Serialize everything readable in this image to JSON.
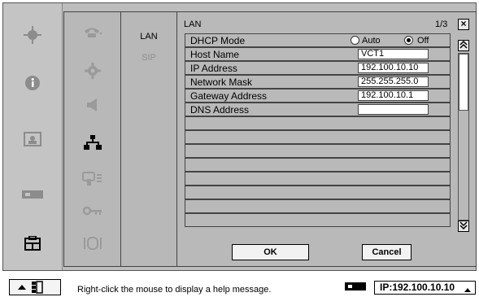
{
  "title": "LAN",
  "page_indicator": "1/3",
  "close_label": "×",
  "sidebar": {
    "icons": [
      "video-conference-icon",
      "info-icon",
      "camera-icon",
      "projector-icon",
      "layout-icon"
    ]
  },
  "categories": [
    "phone-icon",
    "gear-icon",
    "speaker-icon",
    "network-icon",
    "display-icon",
    "key-icon",
    "media-icon"
  ],
  "subcategories": [
    "LAN",
    "SIP"
  ],
  "rows": [
    {
      "label": "DHCP Mode",
      "type": "radio",
      "options": [
        "Auto",
        "Off"
      ],
      "selected": "Off"
    },
    {
      "label": "Host Name",
      "type": "text",
      "value": "VCT1"
    },
    {
      "label": "IP Address",
      "type": "text",
      "value": "192.100.10.10"
    },
    {
      "label": "Network Mask",
      "type": "text",
      "value": "255.255.255.0"
    },
    {
      "label": "Gateway Address",
      "type": "text",
      "value": "192.100.10.1"
    },
    {
      "label": "DNS Address",
      "type": "text",
      "value": ""
    }
  ],
  "buttons": {
    "ok": "OK",
    "cancel": "Cancel"
  },
  "status": {
    "help": "Right-click the mouse to display a help message.",
    "ip": "IP:192.100.10.10"
  }
}
